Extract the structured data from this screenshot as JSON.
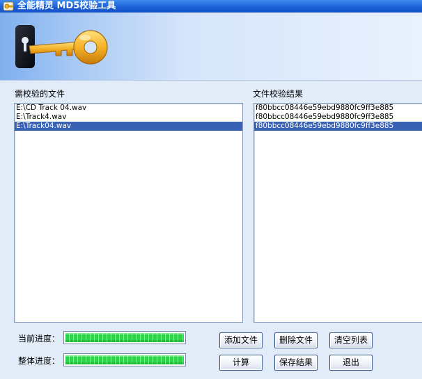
{
  "window": {
    "title": "全能精灵 MD5校验工具"
  },
  "files_panel": {
    "label": "需校验的文件",
    "items": [
      {
        "text": "E:\\CD Track 04.wav",
        "selected": false
      },
      {
        "text": "E:\\Track4.wav",
        "selected": false
      },
      {
        "text": "E:\\Track04.wav",
        "selected": true
      }
    ]
  },
  "results_panel": {
    "label": "文件校验结果",
    "items": [
      {
        "text": "f80bbcc08446e59ebd9880fc9ff3e885",
        "selected": false
      },
      {
        "text": "f80bbcc08446e59ebd9880fc9ff3e885",
        "selected": false
      },
      {
        "text": "f80bbcc08446e59ebd9880fc9ff3e885",
        "selected": true
      }
    ]
  },
  "progress": {
    "current_label": "当前进度：",
    "current_value": 1.0,
    "overall_label": "整体进度：",
    "overall_value": 1.0
  },
  "buttons": {
    "add_file": "添加文件",
    "delete_file": "删除文件",
    "clear_list": "清空列表",
    "compute": "计算",
    "save_result": "保存结果",
    "exit": "退出"
  },
  "icons": {
    "app": "key-app-icon",
    "banner": "golden-key-icon"
  },
  "colors": {
    "selection": "#3a62b4",
    "progress_green": "#2bd048",
    "titlebar": "#1b5fd6"
  }
}
